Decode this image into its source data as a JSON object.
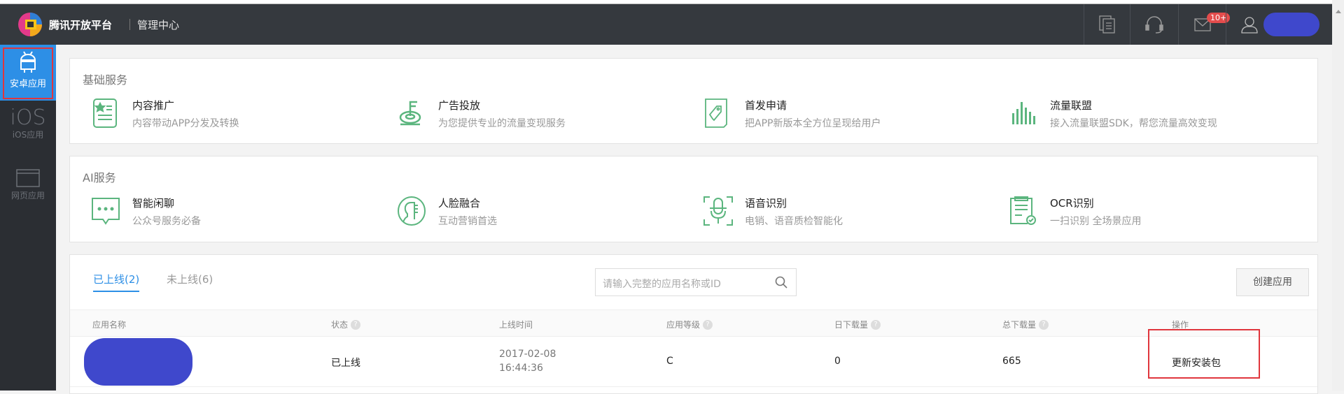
{
  "header": {
    "brand": "腾讯开放平台",
    "center": "管理中心",
    "badge": "10+"
  },
  "sidebar": {
    "items": [
      {
        "label": "安卓应用"
      },
      {
        "label": "iOS应用",
        "glyph": "iOS"
      },
      {
        "label": "网页应用"
      }
    ]
  },
  "basic": {
    "title": "基础服务",
    "items": [
      {
        "name": "内容推广",
        "desc": "内容带动APP分发及转换"
      },
      {
        "name": "广告投放",
        "desc": "为您提供专业的流量变现服务"
      },
      {
        "name": "首发申请",
        "desc": "把APP新版本全方位呈现给用户"
      },
      {
        "name": "流量联盟",
        "desc": "接入流量联盟SDK，帮您流量高效变现"
      }
    ]
  },
  "ai": {
    "title": "AI服务",
    "items": [
      {
        "name": "智能闲聊",
        "desc": "公众号服务必备"
      },
      {
        "name": "人脸融合",
        "desc": "互动营销首选"
      },
      {
        "name": "语音识别",
        "desc": "电销、语音质检智能化"
      },
      {
        "name": "OCR识别",
        "desc": "一扫识别 全场景应用"
      }
    ]
  },
  "apps": {
    "tabs": [
      {
        "label": "已上线(2)"
      },
      {
        "label": "未上线(6)"
      }
    ],
    "search_placeholder": "请输入完整的应用名称或ID",
    "create_label": "创建应用",
    "columns": [
      "应用名称",
      "状态",
      "上线时间",
      "应用等级",
      "日下载量",
      "总下载量",
      "操作"
    ],
    "rows": [
      {
        "status": "已上线",
        "date": "2017-02-08",
        "time": "16:44:36",
        "level": "C",
        "daily": "0",
        "total": "665",
        "action": "更新安装包"
      }
    ]
  },
  "colors": {
    "accent": "#2d8fe6",
    "green": "#5bb57e",
    "header": "#35393e"
  }
}
